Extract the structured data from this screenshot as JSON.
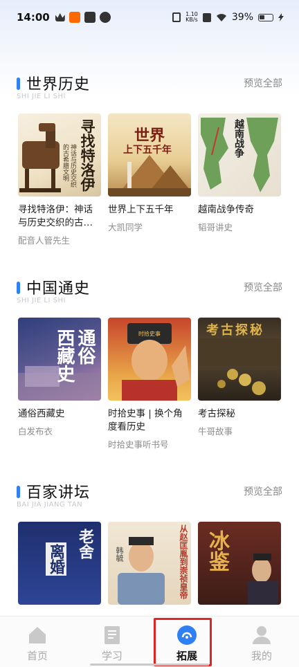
{
  "status_bar": {
    "time": "14:00",
    "net_speed_top": "1.10",
    "net_speed_bottom": "KB/s",
    "battery": "39%"
  },
  "sections": [
    {
      "title": "世界历史",
      "pinyin": "SHI JIE LI SHI",
      "more": "预览全部",
      "items": [
        {
          "title": "寻找特洛伊：神话与历史交织的古…",
          "author": "配音人管先生",
          "cover_text": "寻找特洛伊",
          "cover_sub": "神话与历史交织的古希腊文明"
        },
        {
          "title": "世界上下五千年",
          "author": "大凯同学",
          "cover_text": "世界",
          "cover_sub": "上下五千年"
        },
        {
          "title": "越南战争传奇",
          "author": "韬哥讲史",
          "cover_text": "越南战争",
          "cover_sub": ""
        }
      ]
    },
    {
      "title": "中国通史",
      "pinyin": "SHI JIE LI SHI",
      "more": "预览全部",
      "items": [
        {
          "title": "通俗西藏史",
          "author": "白发布衣",
          "cover_text": "通俗",
          "cover_sub": "西藏史"
        },
        {
          "title": "时拾史事 | 换个角度看历史",
          "author": "时拾史事听书号",
          "cover_text": "时拾史事",
          "cover_sub": ""
        },
        {
          "title": "考古探秘",
          "author": "牛哥故事",
          "cover_text": "考古探秘",
          "cover_sub": ""
        }
      ]
    },
    {
      "title": "百家讲坛",
      "pinyin": "BAI JIA JIANG TAN",
      "more": "预览全部",
      "items": [
        {
          "title": "",
          "author": "",
          "cover_text": "老舍",
          "cover_sub": "离婚"
        },
        {
          "title": "",
          "author": "",
          "cover_text": "韩毓",
          "cover_sub": "从赵匡胤到崇祯皇帝"
        },
        {
          "title": "",
          "author": "",
          "cover_text": "冰鉴",
          "cover_sub": ""
        }
      ]
    }
  ],
  "nav": [
    {
      "label": "首页",
      "icon": "home-icon",
      "active": false
    },
    {
      "label": "学习",
      "icon": "book-icon",
      "active": false
    },
    {
      "label": "拓展",
      "icon": "explore-icon",
      "active": true
    },
    {
      "label": "我的",
      "icon": "user-icon",
      "active": false
    }
  ],
  "colors": {
    "accent": "#2f7ff5",
    "highlight": "#e02424"
  }
}
